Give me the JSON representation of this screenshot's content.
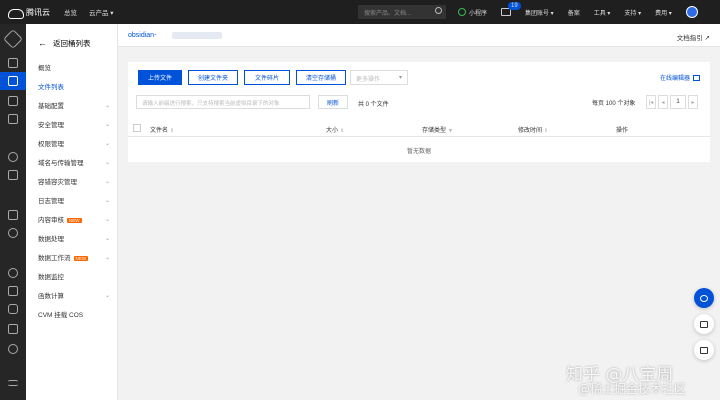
{
  "topbar": {
    "brand": "腾讯云",
    "nav": [
      "总览",
      "云产品 ▾"
    ],
    "search_placeholder": "搜索产品、文档...",
    "mini_program": "小程序",
    "mail_badge": "19",
    "items": [
      "集团账号 ▾",
      "备案",
      "工具 ▾",
      "支持 ▾",
      "费用 ▾"
    ]
  },
  "sidebar": {
    "back_label": "返回桶列表",
    "items": [
      {
        "label": "概览",
        "chevron": false,
        "active": false
      },
      {
        "label": "文件列表",
        "chevron": false,
        "active": true
      },
      {
        "label": "基础配置",
        "chevron": true
      },
      {
        "label": "安全管理",
        "chevron": true
      },
      {
        "label": "权限管理",
        "chevron": true
      },
      {
        "label": "域名与传输管理",
        "chevron": true
      },
      {
        "label": "容错容灾管理",
        "chevron": true
      },
      {
        "label": "日志管理",
        "chevron": true
      },
      {
        "label": "内容审核",
        "chevron": true,
        "tag": "NEW"
      },
      {
        "label": "数据处理",
        "chevron": true
      },
      {
        "label": "数据工作流",
        "chevron": true,
        "tag": "NEW"
      },
      {
        "label": "数据监控",
        "chevron": false
      },
      {
        "label": "函数计算",
        "chevron": true
      },
      {
        "label": "CVM 挂载 COS",
        "chevron": false
      }
    ]
  },
  "header": {
    "bucket_name": "obsidian-",
    "doc_link": "文档指引 ↗"
  },
  "toolbar": {
    "upload": "上传文件",
    "create_folder": "创建文件夹",
    "fragments": "文件碎片",
    "clear_bucket": "清空存储桶",
    "more_ops": "更多操作",
    "online_editor": "在线编辑器"
  },
  "filter": {
    "search_placeholder": "请输入前缀进行搜索，只支持搜索当前虚拟目录下的对象",
    "refresh": "刷新",
    "count": "共 0 个文件",
    "per_page": "每页 100 个对象",
    "page": "1"
  },
  "table": {
    "columns": [
      "文件名",
      "大小",
      "存储类型",
      "修改时间",
      "操作"
    ],
    "empty": "暂无数据"
  },
  "watermark": {
    "line1": "知乎 @八宝周",
    "line2": "@稀土掘金技术社区"
  }
}
